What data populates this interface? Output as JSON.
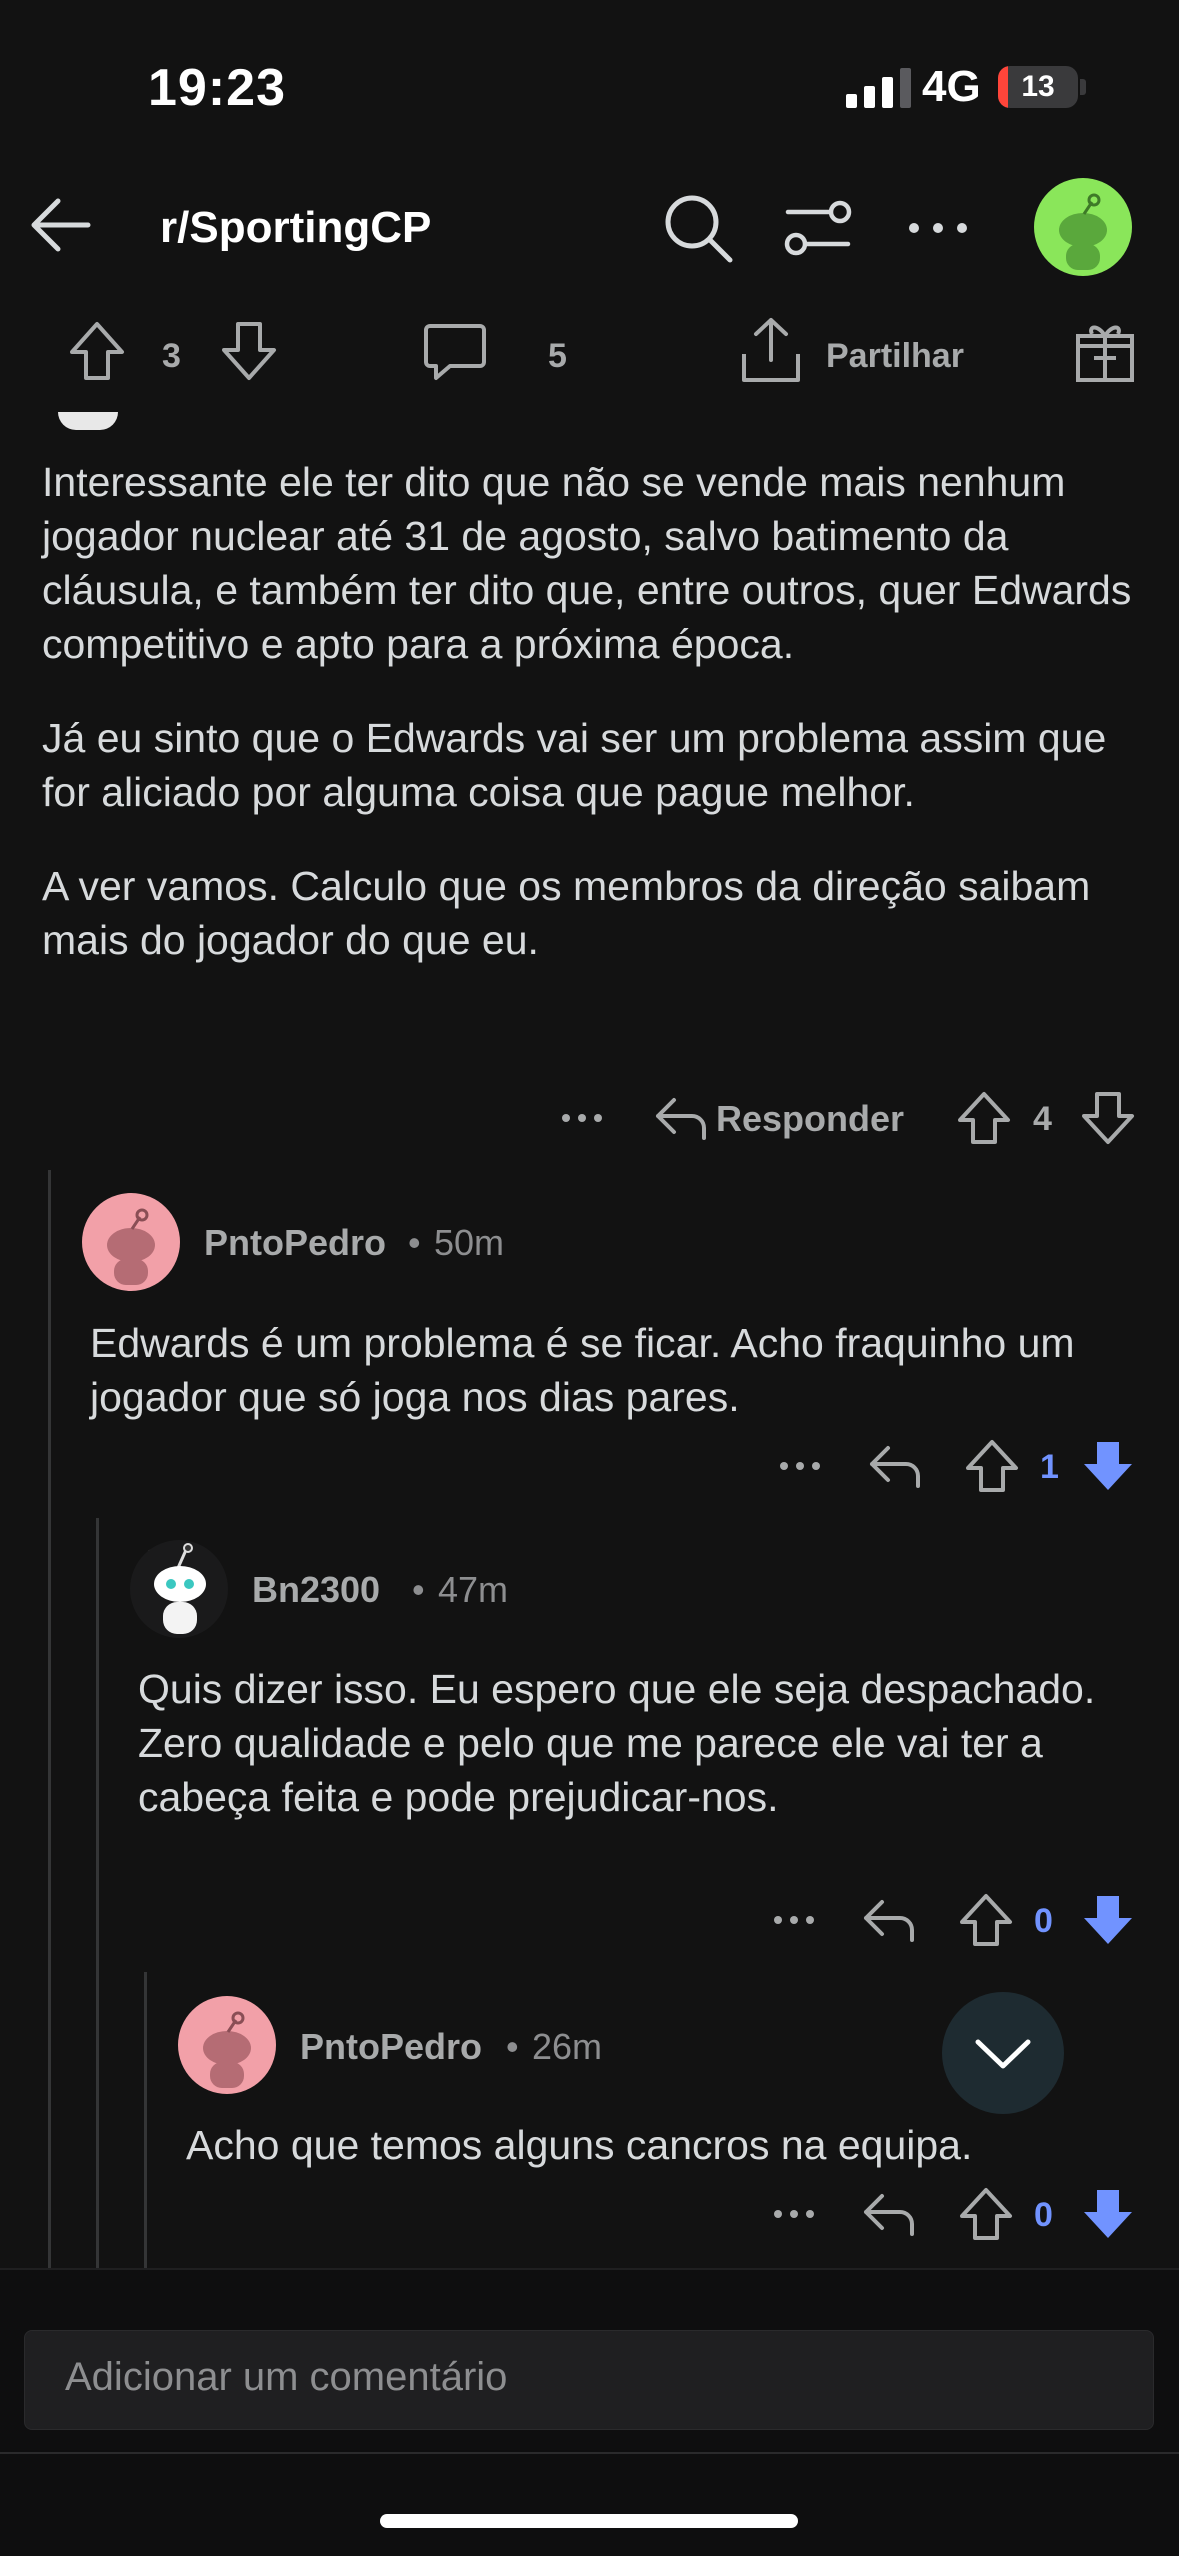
{
  "status_bar": {
    "time": "19:23",
    "network": "4G",
    "battery": "13",
    "battery_fraction": 0.13
  },
  "header": {
    "subreddit": "r/SportingCP"
  },
  "post_actions": {
    "score": "3",
    "comments": "5",
    "share_label": "Partilhar"
  },
  "comments": [
    {
      "paragraphs": [
        "Interessante ele ter dito que não se vende mais nenhum jogador nuclear até 31 de agosto, salvo batimento da cláusula, e também ter dito que, entre outros, quer Edwards competitivo e apto para a próxima época.",
        "Já eu sinto que o Edwards vai ser um problema assim que for aliciado por alguma coisa que pague melhor.",
        "A ver vamos. Calculo que os membros da direção saibam mais do jogador do que eu."
      ],
      "reply_label": "Responder",
      "score": "4"
    },
    {
      "username": "PntoPedro",
      "time": "50m",
      "text": "Edwards é um problema é se ficar. Acho fraquinho um jogador que só joga nos dias pares.",
      "score": "1",
      "downvoted": true
    },
    {
      "username": "Bn2300",
      "time": "47m",
      "text": "Quis dizer isso. Eu espero que ele seja despachado. Zero qualidade e pelo que me parece ele vai ter a cabeça feita e pode prejudicar-nos.",
      "score": "0",
      "downvoted": true
    },
    {
      "username": "PntoPedro",
      "time": "26m",
      "text": "Acho que temos alguns cancros na equipa.",
      "score": "0",
      "downvoted": true
    }
  ],
  "separator": "•",
  "composer": {
    "placeholder": "Adicionar um comentário"
  },
  "colors": {
    "background": "#121212",
    "text": "#d7dadc",
    "muted": "#a8aaab",
    "downvote": "#7193ff",
    "avatar_green": "#8ae65a",
    "avatar_pink": "#f2a0a8"
  },
  "icons": [
    "back-arrow-icon",
    "search-icon",
    "filter-icon",
    "more-icon",
    "upvote-icon",
    "downvote-icon",
    "comment-icon",
    "share-icon",
    "award-icon",
    "reply-icon",
    "chevron-down-icon",
    "snoo-avatar-icon"
  ]
}
